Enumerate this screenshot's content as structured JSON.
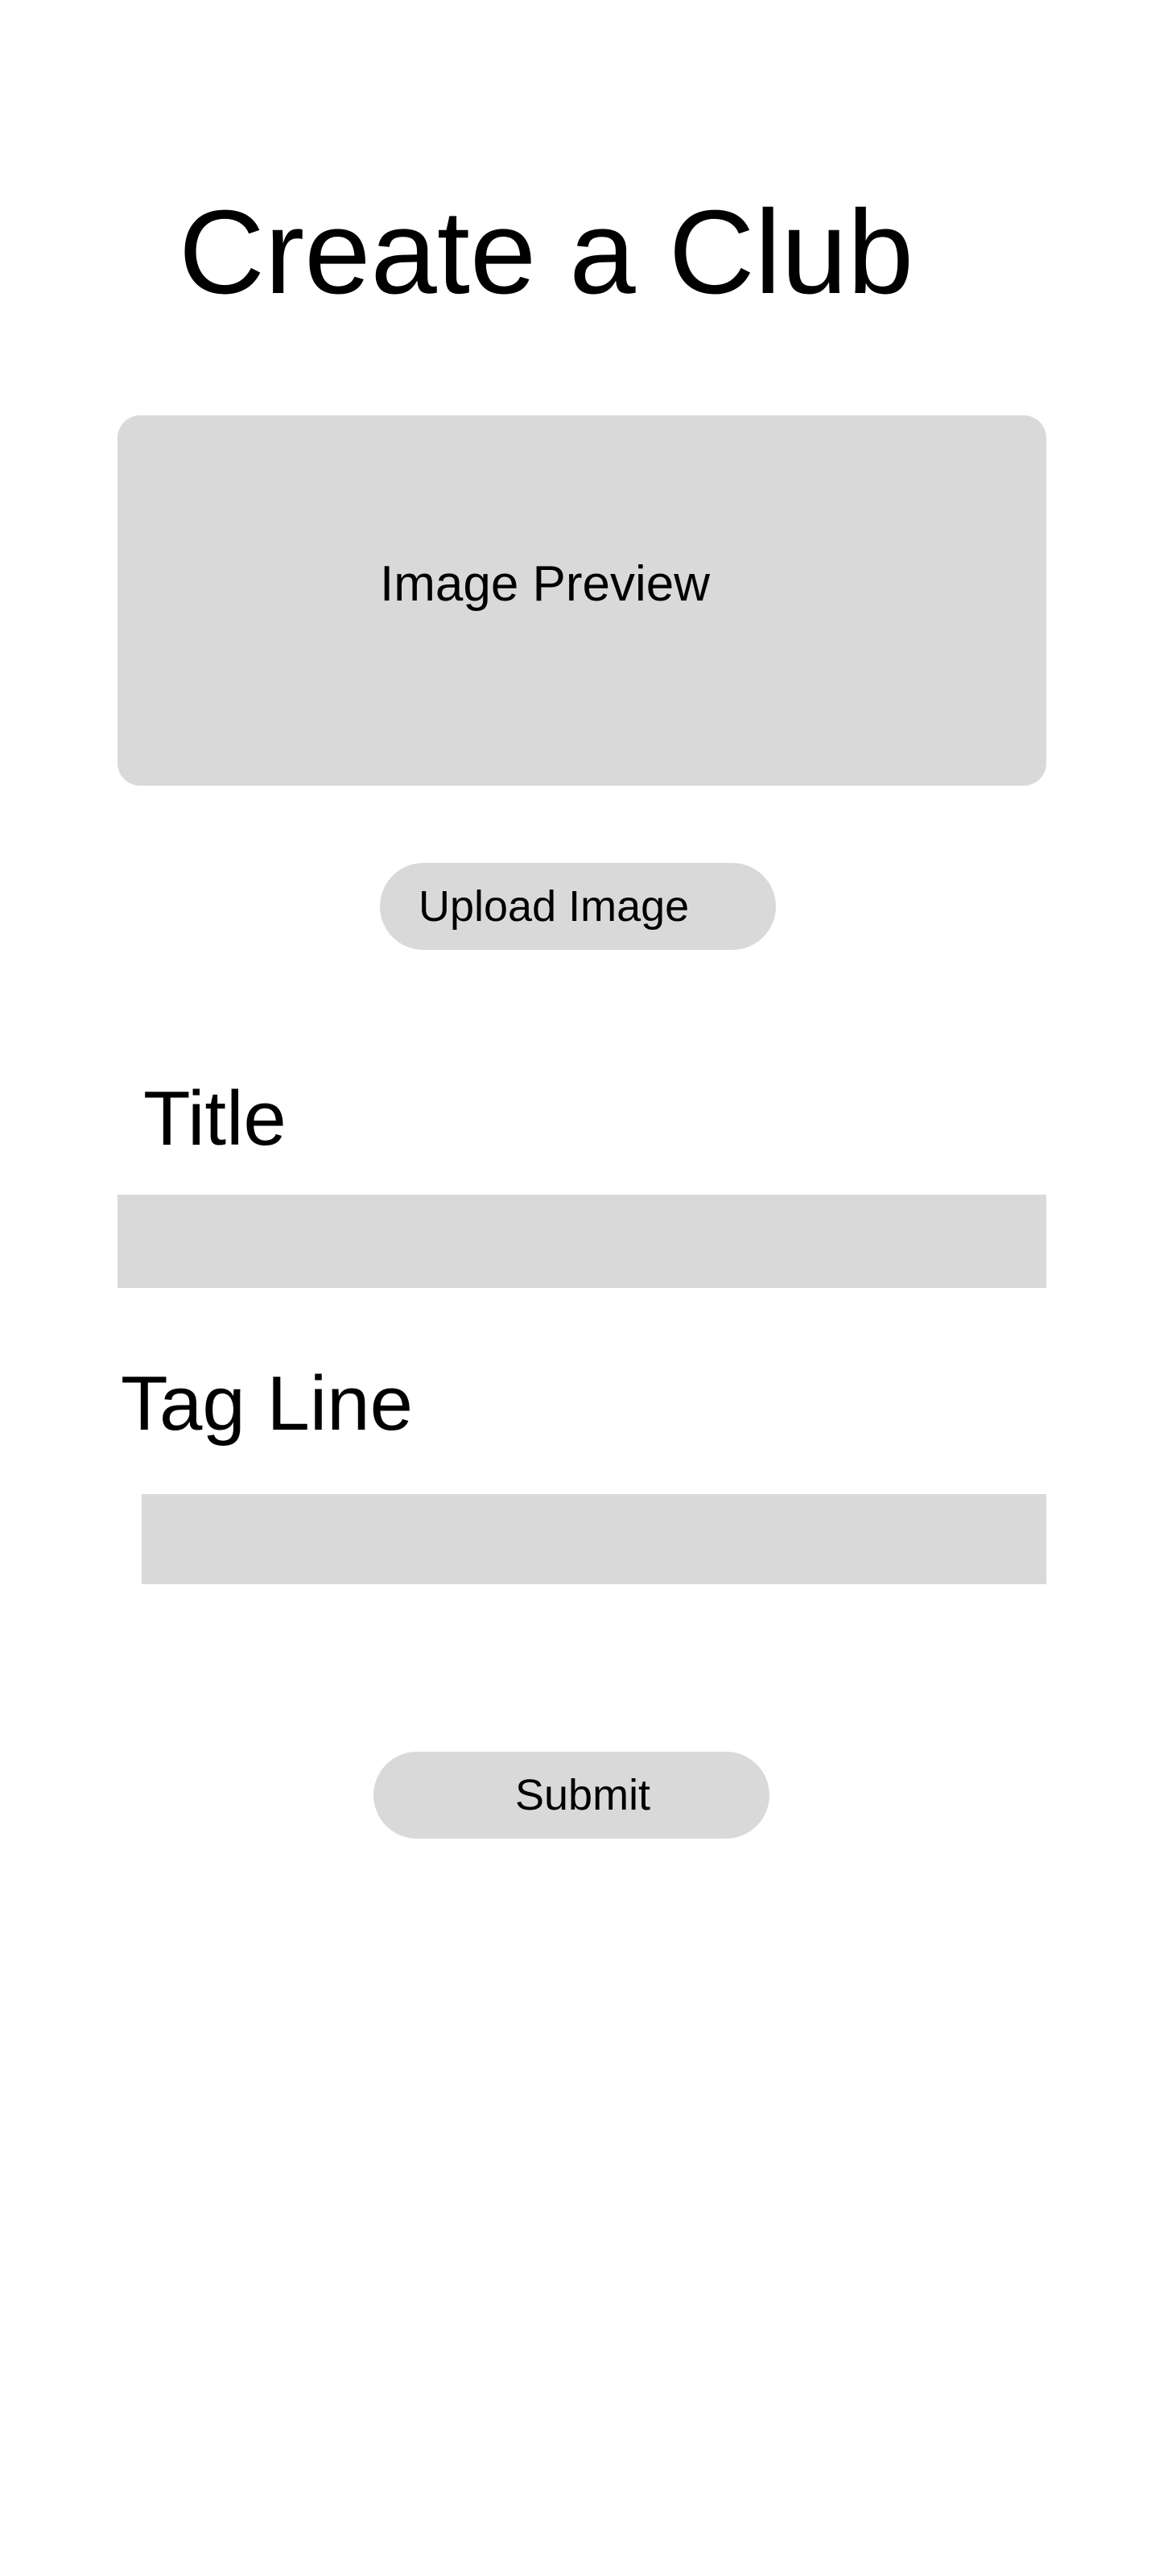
{
  "page": {
    "title": "Create a Club"
  },
  "image_preview": {
    "label": "Image Preview"
  },
  "upload_button": {
    "label": "Upload Image"
  },
  "form": {
    "title_label": "Title",
    "title_value": "",
    "title_placeholder": "",
    "tagline_label": "Tag Line",
    "tagline_value": "",
    "tagline_placeholder": ""
  },
  "submit_button": {
    "label": "Submit"
  },
  "colors": {
    "background": "#ffffff",
    "placeholder_fill": "#d9d9d9",
    "text": "#000000"
  }
}
